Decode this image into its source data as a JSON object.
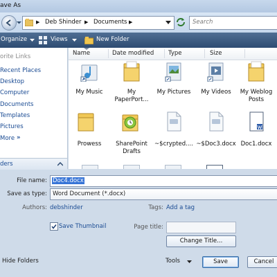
{
  "window": {
    "title": "ave As"
  },
  "address": {
    "crumbs": [
      "Deb Shinder",
      "Documents"
    ],
    "search_placeholder": "Search"
  },
  "toolbar": {
    "organize": "Organize",
    "views": "Views",
    "new_folder": "New Folder"
  },
  "left_nav": {
    "header": "orite Links",
    "links": [
      "Recent Places",
      "Desktop",
      "Computer",
      "Documents",
      "Templates",
      "Pictures"
    ],
    "more": "More",
    "folders": "ders"
  },
  "columns": [
    "Name",
    "Date modified",
    "Type",
    "Size"
  ],
  "items_row1": [
    {
      "label": "My Music",
      "icon": "music-folder-icon"
    },
    {
      "label": "My PaperPort...",
      "icon": "folder-icon"
    },
    {
      "label": "My Pictures",
      "icon": "pictures-folder-icon"
    },
    {
      "label": "My Videos",
      "icon": "videos-folder-icon"
    },
    {
      "label": "My Weblog Posts",
      "icon": "folder-icon"
    }
  ],
  "items_row2": [
    {
      "label": "Prowess",
      "icon": "folder-icon"
    },
    {
      "label": "SharePoint Drafts",
      "icon": "sharepoint-folder-icon"
    },
    {
      "label": "~$crypted....",
      "icon": "document-icon"
    },
    {
      "label": "~$Doc3.docx",
      "icon": "document-icon"
    },
    {
      "label": "Doc1.docx",
      "icon": "word-document-icon"
    }
  ],
  "form": {
    "file_name_label": "File name:",
    "file_name_value": "Doc4.docx",
    "save_type_label": "Save as type:",
    "save_type_value": "Word Document (*.docx)",
    "authors_label": "Authors:",
    "authors_value": "debshinder",
    "tags_label": "Tags:",
    "tags_value": "Add a tag",
    "save_thumbnail": "Save Thumbnail",
    "page_title_label": "Page title:",
    "change_title": "Change Title...",
    "hide_folders": "Hide Folders",
    "tools": "Tools",
    "save": "Save",
    "cancel": "Cancel"
  }
}
